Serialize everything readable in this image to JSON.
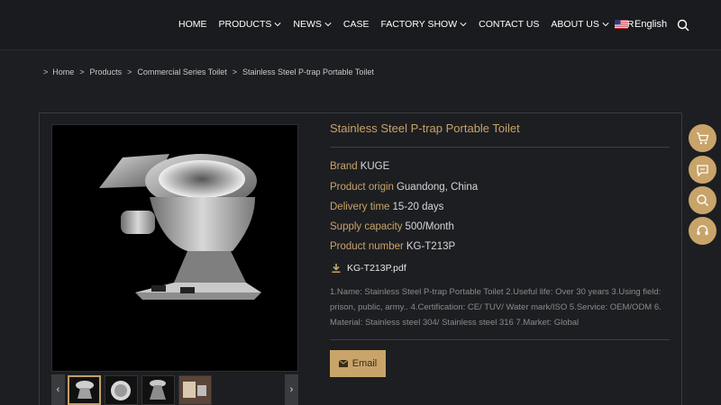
{
  "nav": {
    "items": [
      {
        "label": "HOME",
        "dropdown": false
      },
      {
        "label": "PRODUCTS",
        "dropdown": true
      },
      {
        "label": "NEWS",
        "dropdown": true
      },
      {
        "label": "CASE",
        "dropdown": false
      },
      {
        "label": "FACTORY SHOW",
        "dropdown": true
      },
      {
        "label": "CONTACT US",
        "dropdown": false
      },
      {
        "label": "ABOUT US",
        "dropdown": true
      },
      {
        "label": "VR",
        "dropdown": false
      }
    ],
    "language": "English",
    "icons": {
      "flag": "us-flag-icon",
      "search": "search-icon",
      "dropdown": "chevron-down-icon"
    }
  },
  "breadcrumb": {
    "lead": ">",
    "items": [
      "Home",
      "Products",
      "Commercial Series Toilet",
      "Stainless Steel P-trap Portable Toilet"
    ],
    "separator": ">"
  },
  "product": {
    "title": "Stainless Steel P-trap Portable Toilet",
    "specs": [
      {
        "key": "Brand",
        "value": "KUGE"
      },
      {
        "key": "Product origin",
        "value": "Guandong, China"
      },
      {
        "key": "Delivery time",
        "value": "15-20 days"
      },
      {
        "key": "Supply capacity",
        "value": "500/Month"
      },
      {
        "key": "Product number",
        "value": "KG-T213P"
      }
    ],
    "pdf": "KG-T213P.pdf",
    "description": "1.Name: Stainless Steel P-trap Portable Toilet 2.Useful life: Over 30 years 3.Using field: prison, public, army.. 4.Certification: CE/ TUV/ Water mark/ISO 5.Service: OEM/ODM 6. Material: Stainless steel 304/ Stainless steel 316 7.Market: Global",
    "email_label": "Email"
  },
  "gallery": {
    "prev": "‹",
    "next": "›",
    "thumbs": [
      "toilet-front",
      "round-bowl",
      "toilet-pedestal",
      "installed-room"
    ],
    "active_index": 0
  },
  "float_buttons": [
    "cart-icon",
    "chat-icon",
    "search-icon",
    "headset-icon"
  ],
  "colors": {
    "accent": "#c8a46a",
    "background": "#1d1e21",
    "header": "#1a1b1e"
  }
}
